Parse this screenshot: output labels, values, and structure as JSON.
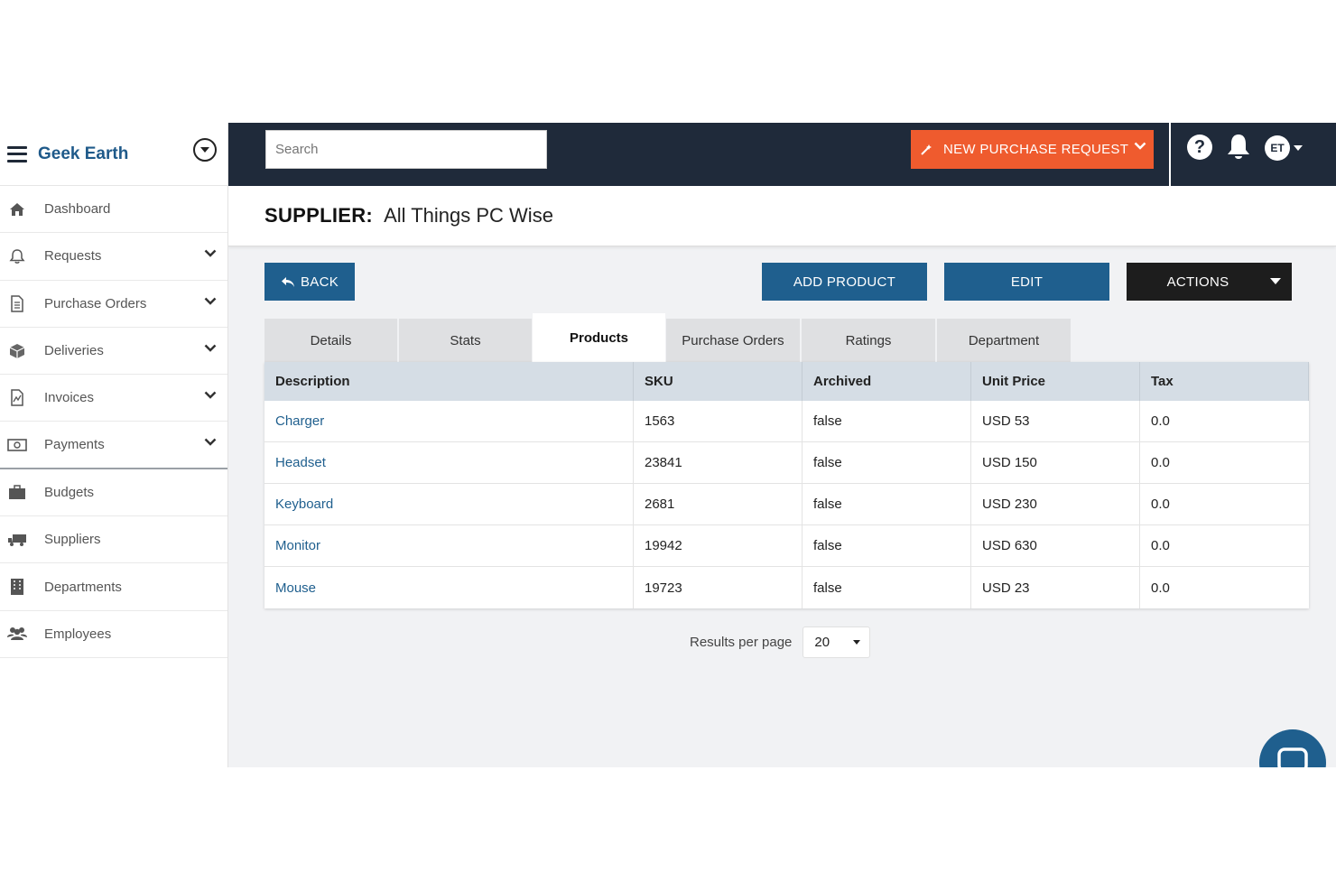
{
  "brand": {
    "name": "Geek Earth"
  },
  "sidebar": {
    "items": [
      {
        "label": "Dashboard",
        "icon": "home-icon",
        "expandable": false
      },
      {
        "label": "Requests",
        "icon": "bell-icon",
        "expandable": true
      },
      {
        "label": "Purchase Orders",
        "icon": "document-icon",
        "expandable": true
      },
      {
        "label": "Deliveries",
        "icon": "box-icon",
        "expandable": true
      },
      {
        "label": "Invoices",
        "icon": "invoice-icon",
        "expandable": true
      },
      {
        "label": "Payments",
        "icon": "money-icon",
        "expandable": true
      },
      {
        "label": "Budgets",
        "icon": "briefcase-icon",
        "expandable": false
      },
      {
        "label": "Suppliers",
        "icon": "truck-icon",
        "expandable": false
      },
      {
        "label": "Departments",
        "icon": "building-icon",
        "expandable": false
      },
      {
        "label": "Employees",
        "icon": "users-icon",
        "expandable": false
      }
    ]
  },
  "topbar": {
    "search_placeholder": "Search",
    "new_request_label": "NEW PURCHASE REQUEST",
    "help_glyph": "?",
    "avatar_initials": "ET"
  },
  "header": {
    "label": "SUPPLIER:",
    "value": "All Things PC Wise"
  },
  "buttons": {
    "back": "BACK",
    "add": "ADD PRODUCT",
    "edit": "EDIT",
    "actions": "ACTIONS"
  },
  "tabs": [
    "Details",
    "Stats",
    "Products",
    "Purchase Orders",
    "Ratings",
    "Department"
  ],
  "active_tab": "Products",
  "table": {
    "columns": [
      "Description",
      "SKU",
      "Archived",
      "Unit Price",
      "Tax"
    ],
    "rows": [
      [
        "Charger",
        "1563",
        "false",
        "USD 53",
        "0.0"
      ],
      [
        "Headset",
        "23841",
        "false",
        "USD 150",
        "0.0"
      ],
      [
        "Keyboard",
        "2681",
        "false",
        "USD 230",
        "0.0"
      ],
      [
        "Monitor",
        "19942",
        "false",
        "USD 630",
        "0.0"
      ],
      [
        "Mouse",
        "19723",
        "false",
        "USD 23",
        "0.0"
      ]
    ]
  },
  "pagination": {
    "label": "Results per page",
    "value": "20"
  },
  "colors": {
    "primary": "#1f5f8e",
    "accent": "#ef5b2e",
    "topbar": "#1f2a3a",
    "brand": "#1f5a8a"
  }
}
